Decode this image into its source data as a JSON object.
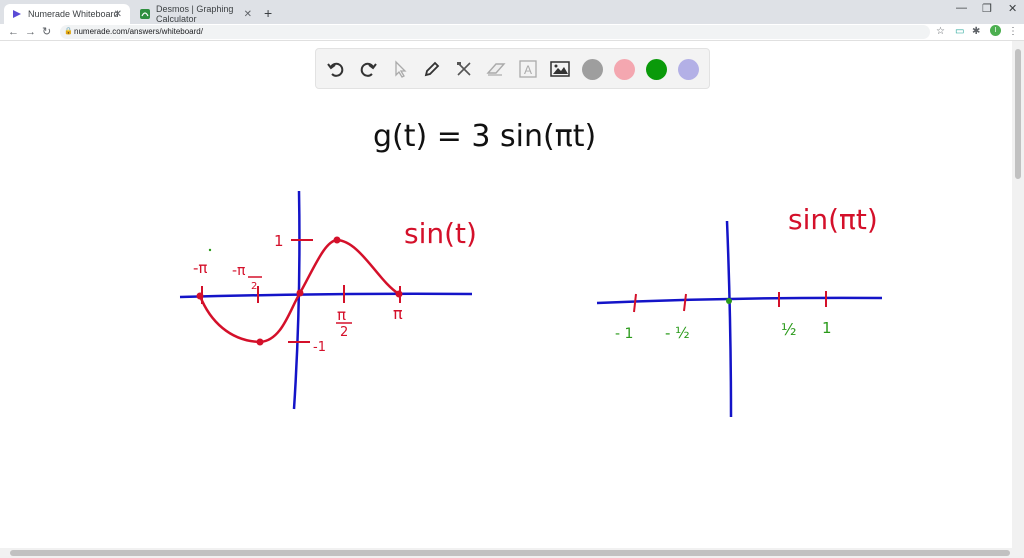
{
  "browser": {
    "tabs": [
      {
        "title": "Numerade Whiteboard",
        "active": true
      },
      {
        "title": "Desmos | Graphing Calculator",
        "active": false
      }
    ],
    "new_tab_label": "+",
    "url": "numerade.com/answers/whiteboard/",
    "profile_initial": "I"
  },
  "whiteboard": {
    "tools": [
      "undo-icon",
      "redo-icon",
      "pointer-icon",
      "pen-icon",
      "tools-icon",
      "eraser-icon",
      "text-icon",
      "image-icon"
    ],
    "text_tool_glyph": "A",
    "colors": [
      "#9e9e9e",
      "#f4a7b0",
      "#0a9a0a",
      "#b3b0e6"
    ],
    "ink": {
      "blue": "#1414c8",
      "red": "#d4102a",
      "green": "#2a9a1a",
      "black": "#111111"
    }
  },
  "drawing": {
    "equation": "g(t) = 3 sin(πt)",
    "left_graph_label": "sin(t)",
    "right_graph_label": "sin(πt)",
    "left_ticks": {
      "neg_pi": "-π",
      "neg_half_pi_num": "-π",
      "neg_half_pi_den": "2",
      "half_pi_num": "π",
      "half_pi_den": "2",
      "pi": "π",
      "one": "1",
      "neg_one": "-1"
    },
    "right_ticks": {
      "neg_one": "- 1",
      "neg_half": "- ½",
      "half": "½",
      "one": "1"
    }
  }
}
